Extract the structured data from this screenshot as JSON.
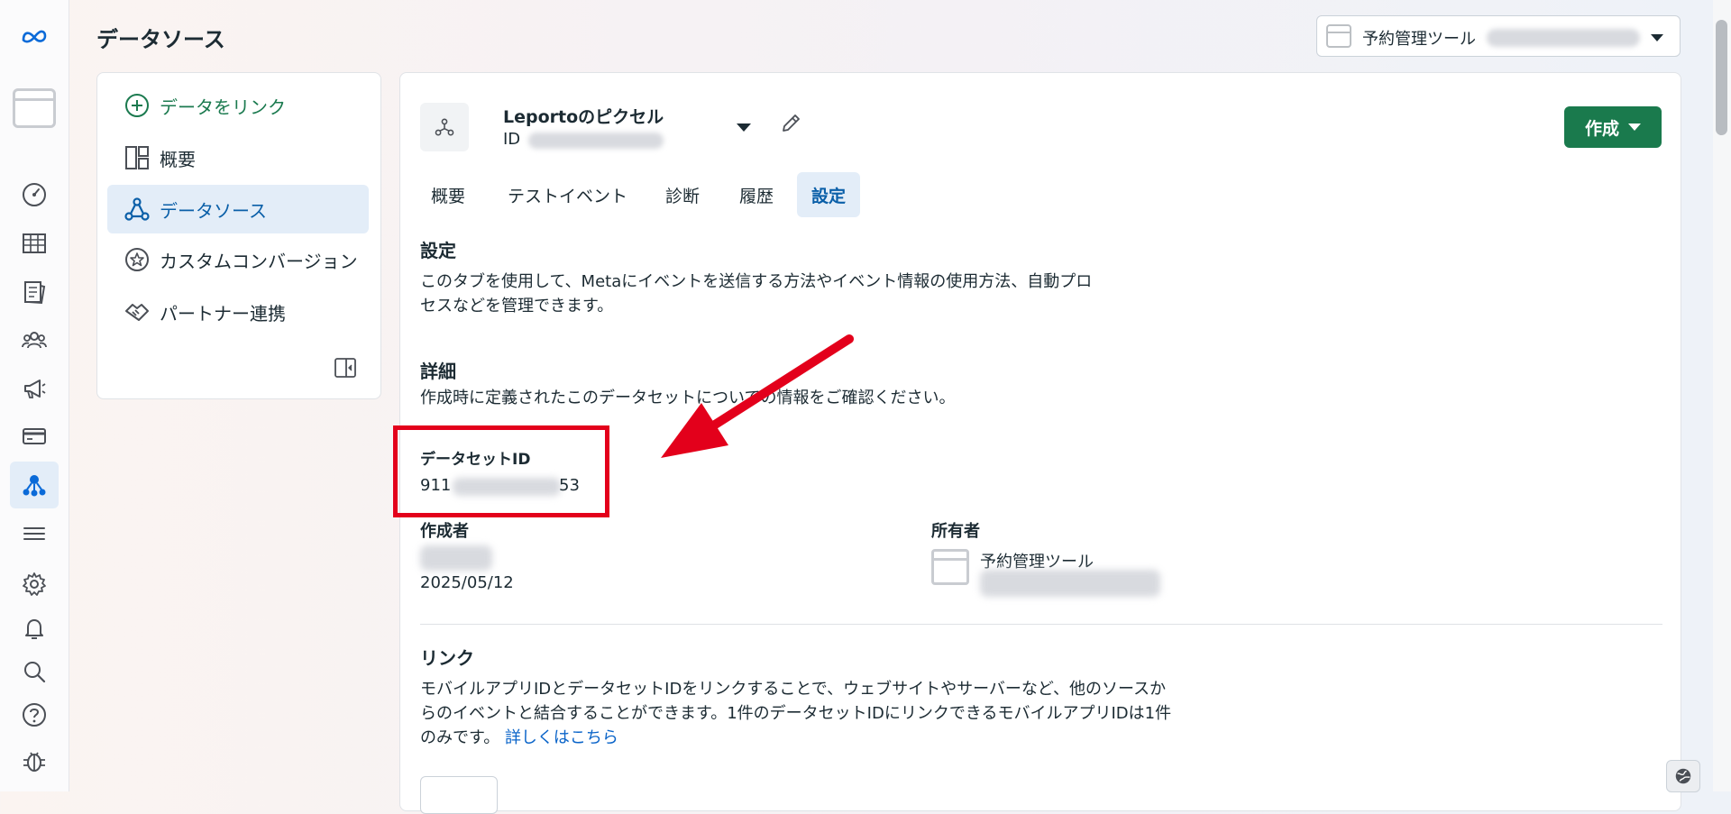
{
  "header": {
    "title": "データソース"
  },
  "account_selector": {
    "label": "予約管理ツール"
  },
  "rail": {
    "icons": [
      "meta-logo",
      "account",
      "dashboard",
      "table",
      "catalog",
      "audiences",
      "ads",
      "billing",
      "data-sources",
      "menu",
      "settings",
      "notifications",
      "search",
      "help",
      "debug"
    ]
  },
  "sidebar": {
    "link_data": "データをリンク",
    "items": [
      {
        "label": "概要",
        "icon": "overview-icon"
      },
      {
        "label": "データソース",
        "icon": "data-sources-icon",
        "active": true
      },
      {
        "label": "カスタムコンバージョン",
        "icon": "star-icon"
      },
      {
        "label": "パートナー連携",
        "icon": "handshake-icon"
      }
    ]
  },
  "pixel": {
    "name": "Leportoのピクセル",
    "id_label": "ID"
  },
  "create_button": {
    "label": "作成"
  },
  "tabs": [
    {
      "label": "概要"
    },
    {
      "label": "テストイベント"
    },
    {
      "label": "診断"
    },
    {
      "label": "履歴"
    },
    {
      "label": "設定",
      "active": true
    }
  ],
  "settings": {
    "title": "設定",
    "description_line1": "このタブを使用して、Metaにイベントを送信する方法やイベント情報の使用方法、自動プロ",
    "description_line2": "セスなどを管理できます。"
  },
  "details": {
    "title": "詳細",
    "description": "作成時に定義されたこのデータセットについての情報をご確認ください。",
    "dataset_id_label": "データセットID",
    "dataset_id_prefix": "911",
    "dataset_id_suffix": "53",
    "created_by_label": "作成者",
    "created_date": "2025/05/12",
    "owner_label": "所有者",
    "owner_name": "予約管理ツール"
  },
  "links": {
    "title": "リンク",
    "line1": "モバイルアプリIDとデータセットIDをリンクすることで、ウェブサイトやサーバーなど、他のソースか",
    "line2": "らのイベントと結合することができます。1件のデータセットIDにリンクできるモバイルアプリIDは1件",
    "line3": "のみです。",
    "learn_more": "詳しくはこちら"
  },
  "colors": {
    "accent_green": "#1a7a4d",
    "active_blue": "#0a5fa8",
    "highlight_red": "#e3001b"
  }
}
